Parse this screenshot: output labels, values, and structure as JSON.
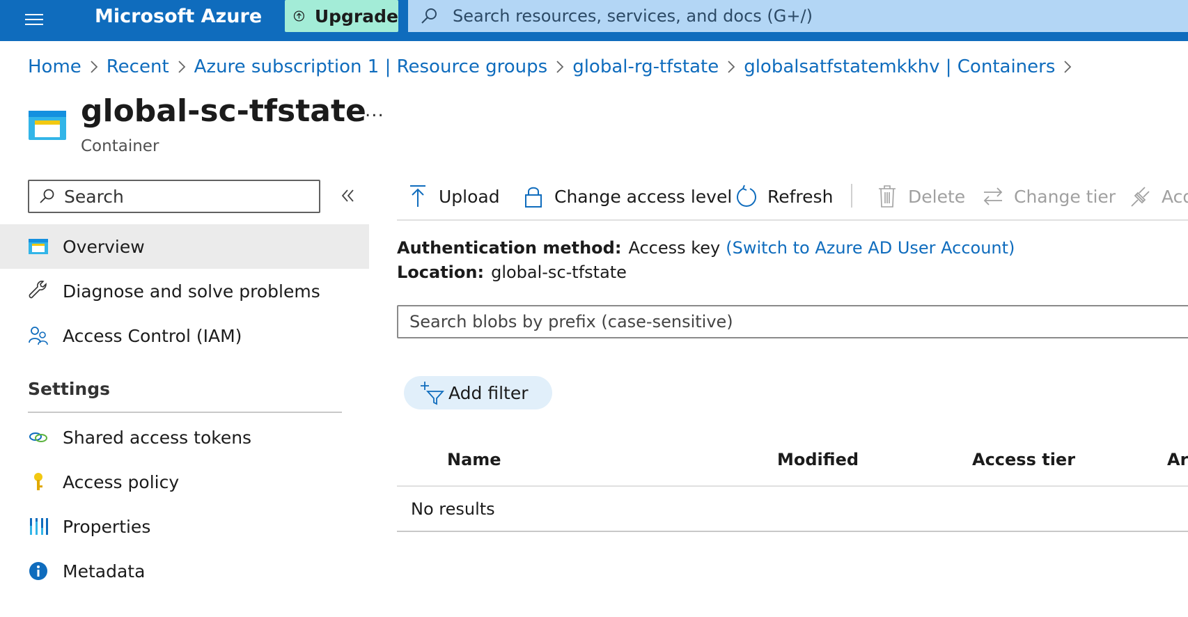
{
  "header": {
    "brand": "Microsoft Azure",
    "upgrade_label": "Upgrade",
    "search_placeholder": "Search resources, services, and docs (G+/)"
  },
  "breadcrumb": [
    "Home",
    "Recent",
    "Azure subscription 1 | Resource groups",
    "global-rg-tfstate",
    "globalsatfstatemkkhv | Containers"
  ],
  "resource": {
    "title": "global-sc-tfstate",
    "type": "Container",
    "more": "..."
  },
  "nav": {
    "search_placeholder": "Search",
    "items": [
      {
        "label": "Overview",
        "icon": "container-icon"
      },
      {
        "label": "Diagnose and solve problems",
        "icon": "wrench-icon"
      },
      {
        "label": "Access Control (IAM)",
        "icon": "people-icon"
      }
    ],
    "settings_title": "Settings",
    "settings_items": [
      {
        "label": "Shared access tokens",
        "icon": "link-icon"
      },
      {
        "label": "Access policy",
        "icon": "key-icon"
      },
      {
        "label": "Properties",
        "icon": "bars-icon"
      },
      {
        "label": "Metadata",
        "icon": "info-icon"
      }
    ]
  },
  "toolbar": {
    "upload": "Upload",
    "change_access": "Change access level",
    "refresh": "Refresh",
    "delete": "Delete",
    "change_tier": "Change tier",
    "acquire_lease": "Acq"
  },
  "info": {
    "auth_label": "Authentication method:",
    "auth_value": "Access key",
    "auth_link": "(Switch to Azure AD User Account)",
    "location_label": "Location:",
    "location_value": "global-sc-tfstate"
  },
  "blob_search_placeholder": "Search blobs by prefix (case-sensitive)",
  "add_filter": "Add filter",
  "table": {
    "columns": [
      "Name",
      "Modified",
      "Access tier",
      "Ar"
    ],
    "empty": "No results"
  },
  "colors": {
    "topbar": "#0f6cbd",
    "upgrade": "#a3ecd7",
    "topsearch": "#b3d6f5",
    "link": "#0f6cbd"
  }
}
